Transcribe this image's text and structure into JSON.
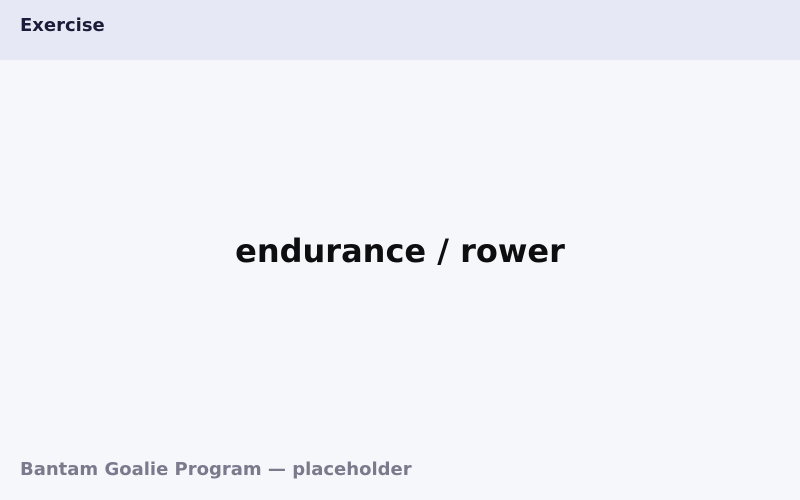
{
  "header": {
    "title": "Exercise"
  },
  "main": {
    "exercise_name": "endurance / rower"
  },
  "footer": {
    "text": "Bantam Goalie Program — placeholder"
  },
  "colors": {
    "header_background": "#e6e9f5",
    "page_background": "#f6f7fb",
    "header_text": "#1c1c3a",
    "main_text": "#0e0e10",
    "footer_text": "#7a7a8c"
  }
}
